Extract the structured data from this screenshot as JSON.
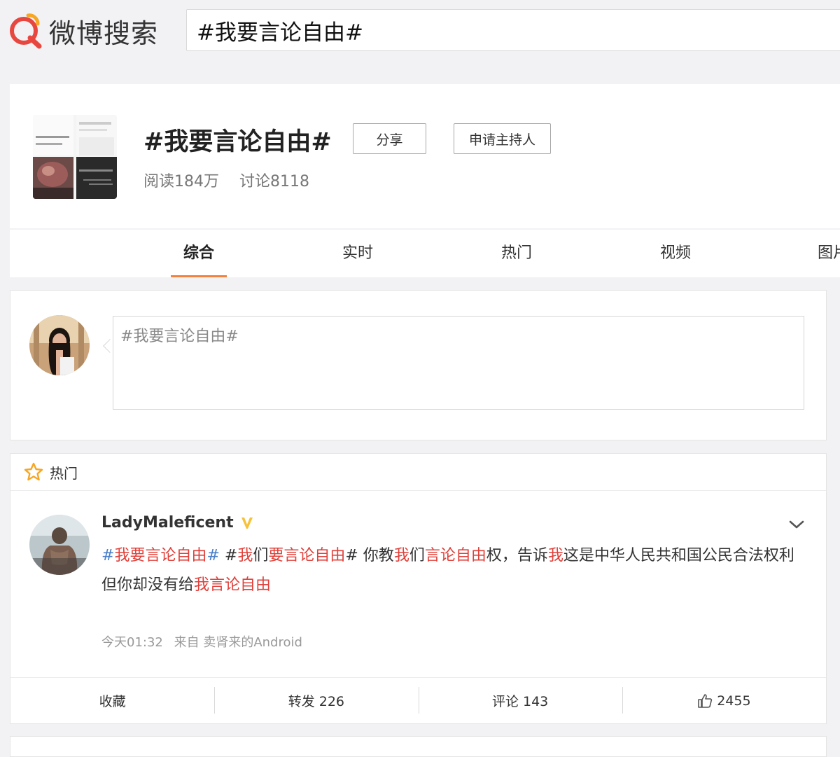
{
  "header": {
    "logo_text": "微博搜索",
    "search_value": "#我要言论自由#"
  },
  "topic": {
    "title": "#我要言论自由#",
    "share_label": "分享",
    "host_label": "申请主持人",
    "reads": "阅读184万",
    "discussions": "讨论8118"
  },
  "tabs": [
    {
      "label": "综合",
      "active": true
    },
    {
      "label": "实时"
    },
    {
      "label": "热门"
    },
    {
      "label": "视频"
    },
    {
      "label": "图片"
    }
  ],
  "composer": {
    "value": "#我要言论自由#"
  },
  "hot": {
    "section_label": "热门",
    "post": {
      "author": "LadyMaleficent",
      "segments": [
        {
          "t": "#",
          "c": "tag-blue"
        },
        {
          "t": "我要言论自由",
          "c": "hl"
        },
        {
          "t": "#",
          "c": "tag-blue"
        },
        {
          "t": " #",
          "c": ""
        },
        {
          "t": "我",
          "c": "hl"
        },
        {
          "t": "们",
          "c": ""
        },
        {
          "t": "要言论自由",
          "c": "hl"
        },
        {
          "t": "# 你教",
          "c": ""
        },
        {
          "t": "我",
          "c": "hl"
        },
        {
          "t": "们",
          "c": ""
        },
        {
          "t": "言论自由",
          "c": "hl"
        },
        {
          "t": "权，告诉",
          "c": ""
        },
        {
          "t": "我",
          "c": "hl"
        },
        {
          "t": "这是中华人民共和国公民合法权利",
          "c": ""
        },
        {
          "br": true
        },
        {
          "t": "但你却没有给",
          "c": ""
        },
        {
          "t": "我言论自由",
          "c": "hl"
        }
      ],
      "time": "今天01:32",
      "source": "来自 卖肾来的Android",
      "actions": {
        "favorite": "收藏",
        "repost": "转发 226",
        "comment": "评论 143",
        "like": "2455"
      }
    }
  },
  "colors": {
    "accent": "#f6813c",
    "highlight": "#e0403a",
    "tag": "#4a7fc9"
  }
}
